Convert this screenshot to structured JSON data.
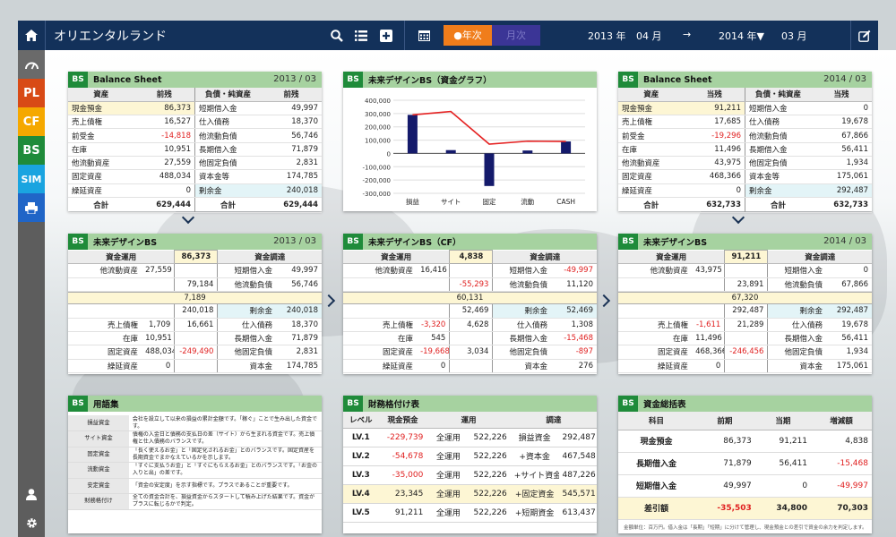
{
  "app": {
    "title": "オリエンタルランド"
  },
  "topbar": {
    "tab_year": "●年次",
    "tab_month": "月次",
    "from_year": "2013 年",
    "from_month": "04 月",
    "arrow": "→",
    "to_year": "2014 年▼",
    "to_month": "03 月"
  },
  "sidebar": {
    "pl": "PL",
    "cf": "CF",
    "bs": "BS",
    "sim": "SIM"
  },
  "colors": {
    "navy": "#13315a",
    "orange": "#f07d1b",
    "pl": "#d84a16",
    "cf": "#f5a800",
    "bs": "#1f8b3a",
    "sim": "#1aa4e0",
    "print": "#2065c7",
    "header_green": "#a6d2a0"
  },
  "bs_tag": "BS",
  "bs_left": {
    "title": "Balance Sheet",
    "date": "2013 / 03",
    "headers": [
      "資産",
      "前残",
      "負債・純資産",
      "前残"
    ],
    "rows": [
      [
        "現金預金",
        "86,373",
        "短期借入金",
        "49,997"
      ],
      [
        "売上債権",
        "16,527",
        "仕入債務",
        "18,370"
      ],
      [
        "前受金",
        "-14,818",
        "他流動負債",
        "56,746"
      ],
      [
        "在庫",
        "10,951",
        "長期借入金",
        "71,879"
      ],
      [
        "他流動資産",
        "27,559",
        "他固定負債",
        "2,831"
      ],
      [
        "固定資産",
        "488,034",
        "資本金等",
        "174,785"
      ],
      [
        "繰延資産",
        "0",
        "剰余金",
        "240,018"
      ]
    ],
    "total": [
      "合計",
      "629,444",
      "合計",
      "629,444"
    ]
  },
  "bs_right": {
    "title": "Balance Sheet",
    "date": "2014 / 03",
    "headers": [
      "資産",
      "当残",
      "負債・純資産",
      "当残"
    ],
    "rows": [
      [
        "現金預金",
        "91,211",
        "短期借入金",
        "0"
      ],
      [
        "売上債権",
        "17,685",
        "仕入債務",
        "19,678"
      ],
      [
        "前受金",
        "-19,296",
        "他流動負債",
        "67,866"
      ],
      [
        "在庫",
        "11,496",
        "長期借入金",
        "56,411"
      ],
      [
        "他流動資産",
        "43,975",
        "他固定負債",
        "1,934"
      ],
      [
        "固定資産",
        "468,366",
        "資本金等",
        "175,061"
      ],
      [
        "繰延資産",
        "0",
        "剰余金",
        "292,487"
      ]
    ],
    "total": [
      "合計",
      "632,733",
      "合計",
      "632,733"
    ]
  },
  "graph": {
    "title": "未来デザインBS（資金グラフ）"
  },
  "chart_data": {
    "type": "bar",
    "categories": [
      "損益",
      "サイト",
      "固定",
      "流動",
      "CASH"
    ],
    "series": [
      {
        "type": "bar",
        "values": [
          290000,
          25000,
          -245000,
          22000,
          90000
        ]
      },
      {
        "type": "line",
        "values": [
          290000,
          315000,
          70000,
          92000,
          90000
        ]
      }
    ],
    "ylim": [
      -300000,
      400000
    ],
    "yticks": [
      "400,000",
      "300,000",
      "200,000",
      "100,000",
      "0",
      "-100,000",
      "-200,000",
      "-300,000"
    ],
    "grid": true
  },
  "fd_left": {
    "title": "未来デザインBS",
    "date": "2013 / 03",
    "h_use": "資金運用",
    "h_val": "86,373",
    "h_raise": "資金調達",
    "top": [
      [
        "他流動資産",
        "27,559",
        "",
        "短期借入金",
        "49,997"
      ],
      [
        "",
        "",
        "79,184",
        "他流動負債",
        "56,746"
      ]
    ],
    "band": "7,189",
    "mid": [
      "",
      "",
      "240,018",
      "剰余金",
      "240,018"
    ],
    "bottom": [
      [
        "売上債権",
        "1,709",
        "16,661",
        "仕入債務",
        "18,370"
      ],
      [
        "在庫",
        "10,951",
        "",
        "長期借入金",
        "71,879"
      ],
      [
        "固定資産",
        "488,034",
        "-249,490",
        "他固定負債",
        "2,831"
      ],
      [
        "繰延資産",
        "0",
        "",
        "資本金",
        "174,785"
      ]
    ]
  },
  "fd_cf": {
    "title": "未来デザインBS（CF）",
    "h_use": "資金運用",
    "h_val": "4,838",
    "h_raise": "資金調達",
    "top": [
      [
        "他流動資産",
        "16,416",
        "",
        "短期借入金",
        "-49,997"
      ],
      [
        "",
        "",
        "-55,293",
        "他流動負債",
        "11,120"
      ]
    ],
    "band": "60,131",
    "mid": [
      "",
      "",
      "52,469",
      "剰余金",
      "52,469"
    ],
    "bottom": [
      [
        "売上債権",
        "-3,320",
        "4,628",
        "仕入債務",
        "1,308"
      ],
      [
        "在庫",
        "545",
        "",
        "長期借入金",
        "-15,468"
      ],
      [
        "固定資産",
        "-19,668",
        "3,034",
        "他固定負債",
        "-897"
      ],
      [
        "繰延資産",
        "0",
        "",
        "資本金",
        "276"
      ]
    ]
  },
  "fd_right": {
    "title": "未来デザインBS",
    "date": "2014 / 03",
    "h_use": "資金運用",
    "h_val": "91,211",
    "h_raise": "資金調達",
    "top": [
      [
        "他流動資産",
        "43,975",
        "",
        "短期借入金",
        "0"
      ],
      [
        "",
        "",
        "23,891",
        "他流動負債",
        "67,866"
      ]
    ],
    "band": "67,320",
    "mid": [
      "",
      "",
      "292,487",
      "剰余金",
      "292,487"
    ],
    "bottom": [
      [
        "売上債権",
        "-1,611",
        "21,289",
        "仕入債務",
        "19,678"
      ],
      [
        "在庫",
        "11,496",
        "",
        "長期借入金",
        "56,411"
      ],
      [
        "固定資産",
        "468,366",
        "-246,456",
        "他固定負債",
        "1,934"
      ],
      [
        "繰延資産",
        "0",
        "",
        "資本金",
        "175,061"
      ]
    ]
  },
  "glossary": {
    "title": "用語集",
    "rows": [
      [
        "損益資金",
        "会社を設立して以来の損益の累計金額です。「稼ぐ」ことで生み出した資金です。"
      ],
      [
        "サイト資金",
        "債権の入金日と債務の支払日の差（サイト）から生まれる資金です。売上債権と仕入債務のバランスです。"
      ],
      [
        "固定資金",
        "「長く使えるお金」と「固定化されるお金」とのバランスです。固定資産を長期資金でまかなえているかを示します。"
      ],
      [
        "流動資金",
        "「すぐに支払うお金」と「すぐにもらえるお金」とのバランスです。「お金の入りと出」の差です。"
      ],
      [
        "安定資金",
        "「資金の安定度」を示す指標です。プラスであることが重要です。"
      ],
      [
        "財務格付け",
        "全ての資金合計を、損益資金からスタートして積み上げた結果です。資金がプラスに転じるかで判定。"
      ]
    ]
  },
  "rating": {
    "title": "財務格付け表",
    "headers": [
      "レベル",
      "現金預金",
      "運用",
      "調達"
    ],
    "rows": [
      [
        "LV.1",
        "-229,739",
        "全運用",
        "522,226",
        "損益資金",
        "292,487"
      ],
      [
        "LV.2",
        "-54,678",
        "全運用",
        "522,226",
        "+資本金",
        "467,548"
      ],
      [
        "LV.3",
        "-35,000",
        "全運用",
        "522,226",
        "+サイト資金",
        "487,226"
      ],
      [
        "LV.4",
        "23,345",
        "全運用",
        "522,226",
        "+固定資金",
        "545,571"
      ],
      [
        "LV.5",
        "91,211",
        "全運用",
        "522,226",
        "+短期資金",
        "613,437"
      ]
    ]
  },
  "summary": {
    "title": "資金総括表",
    "headers": [
      "科目",
      "前期",
      "当期",
      "増減額"
    ],
    "rows": [
      [
        "現金預金",
        "86,373",
        "91,211",
        "4,838"
      ],
      [
        "長期借入金",
        "71,879",
        "56,411",
        "-15,468"
      ],
      [
        "短期借入金",
        "49,997",
        "0",
        "-49,997"
      ]
    ],
    "total": [
      "差引額",
      "-35,503",
      "34,800",
      "70,303"
    ],
    "note": "金額単位：百万円。借入金は「長期」「短期」に分けて管理し、現金預金との差引で資金の余力を判定します。"
  }
}
